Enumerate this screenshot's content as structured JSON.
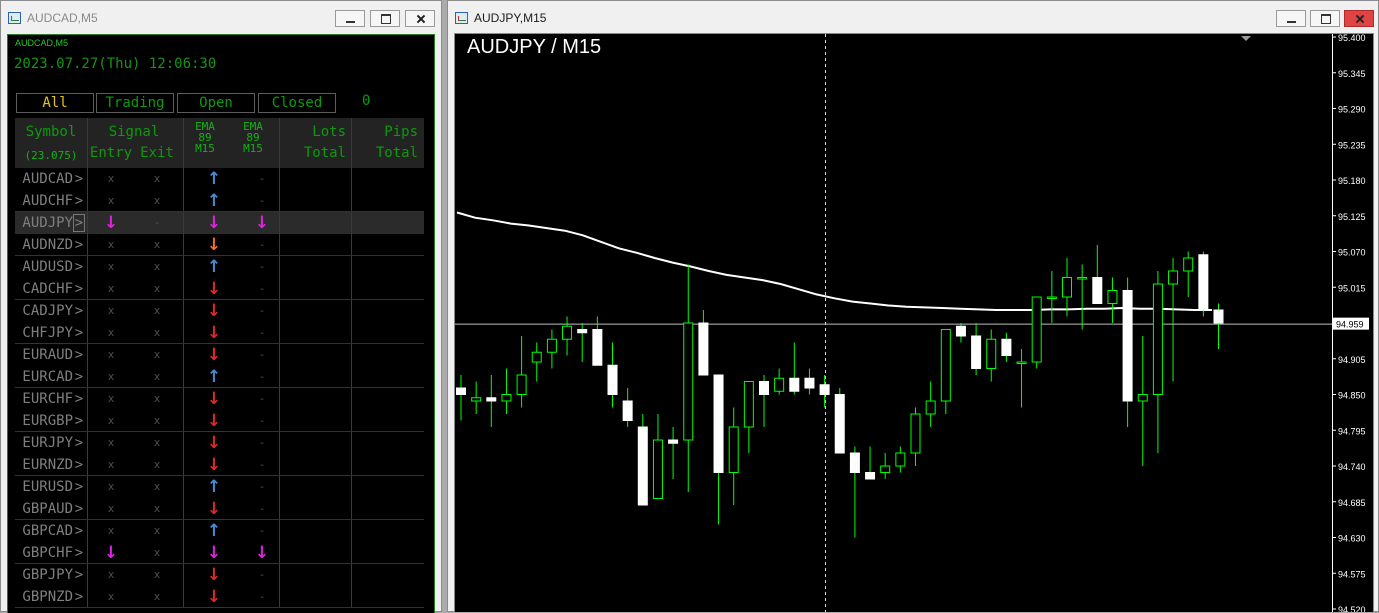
{
  "left_window": {
    "title": "AUDCAD,M5",
    "buttons": {
      "minimize": "minimize",
      "maximize": "maximize",
      "close": "close"
    }
  },
  "right_window": {
    "title": "AUDJPY,M15",
    "buttons": {
      "minimize": "minimize",
      "maximize": "maximize",
      "close": "close"
    }
  },
  "dashboard": {
    "symbol": "AUDCAD,M5",
    "datetime": "2023.07.27(Thu) 12:06:30",
    "filters": [
      "All",
      "Trading",
      "Open",
      "Closed"
    ],
    "active_filter": "All",
    "count": "0",
    "headers": {
      "symbol": "Symbol",
      "symbol_sub": "(23.075)",
      "signal": "Signal",
      "entry": "Entry",
      "exit": "Exit",
      "ema1": "EMA 89 M15",
      "ema2": "EMA 89 M15",
      "lots": "Lots",
      "lots_sub": "Total",
      "pips": "Pips",
      "pips_sub": "Total"
    },
    "rows": [
      {
        "symbol": "AUDCAD",
        "chev": ">",
        "entry": "x",
        "exit": "x",
        "ema1": "↑",
        "ema1_color": "#4a8ad4",
        "ema2": "-",
        "selected": false
      },
      {
        "symbol": "AUDCHF",
        "chev": ">",
        "entry": "x",
        "exit": "x",
        "ema1": "↑",
        "ema1_color": "#4a8ad4",
        "ema2": "-",
        "selected": false
      },
      {
        "symbol": "AUDJPY",
        "chev": ">",
        "entry": "↓",
        "entry_color": "#e020e0",
        "exit": "-",
        "ema1": "↓",
        "ema1_color": "#e020e0",
        "ema2": "↓",
        "ema2_color": "#e020e0",
        "selected": true
      },
      {
        "symbol": "AUDNZD",
        "chev": ">",
        "entry": "x",
        "exit": "x",
        "ema1": "↓",
        "ema1_color": "#f07020",
        "ema2": "-",
        "selected": false
      },
      {
        "symbol": "AUDUSD",
        "chev": ">",
        "entry": "x",
        "exit": "x",
        "ema1": "↑",
        "ema1_color": "#4a8ad4",
        "ema2": "-",
        "selected": false
      },
      {
        "symbol": "CADCHF",
        "chev": ">",
        "entry": "x",
        "exit": "x",
        "ema1": "↓",
        "ema1_color": "#e02828",
        "ema2": "-",
        "selected": false
      },
      {
        "symbol": "CADJPY",
        "chev": ">",
        "entry": "x",
        "exit": "x",
        "ema1": "↓",
        "ema1_color": "#e02828",
        "ema2": "-",
        "selected": false
      },
      {
        "symbol": "CHFJPY",
        "chev": ">",
        "entry": "x",
        "exit": "x",
        "ema1": "↓",
        "ema1_color": "#e02828",
        "ema2": "-",
        "selected": false
      },
      {
        "symbol": "EURAUD",
        "chev": ">",
        "entry": "x",
        "exit": "x",
        "ema1": "↓",
        "ema1_color": "#e02828",
        "ema2": "-",
        "selected": false
      },
      {
        "symbol": "EURCAD",
        "chev": ">",
        "entry": "x",
        "exit": "x",
        "ema1": "↑",
        "ema1_color": "#4a8ad4",
        "ema2": "-",
        "selected": false
      },
      {
        "symbol": "EURCHF",
        "chev": ">",
        "entry": "x",
        "exit": "x",
        "ema1": "↓",
        "ema1_color": "#e02828",
        "ema2": "-",
        "selected": false
      },
      {
        "symbol": "EURGBP",
        "chev": ">",
        "entry": "x",
        "exit": "x",
        "ema1": "↓",
        "ema1_color": "#e02828",
        "ema2": "-",
        "selected": false
      },
      {
        "symbol": "EURJPY",
        "chev": ">",
        "entry": "x",
        "exit": "x",
        "ema1": "↓",
        "ema1_color": "#e02828",
        "ema2": "-",
        "selected": false
      },
      {
        "symbol": "EURNZD",
        "chev": ">",
        "entry": "x",
        "exit": "x",
        "ema1": "↓",
        "ema1_color": "#e02828",
        "ema2": "-",
        "selected": false
      },
      {
        "symbol": "EURUSD",
        "chev": ">",
        "entry": "x",
        "exit": "x",
        "ema1": "↑",
        "ema1_color": "#4a8ad4",
        "ema2": "-",
        "selected": false
      },
      {
        "symbol": "GBPAUD",
        "chev": ">",
        "entry": "x",
        "exit": "x",
        "ema1": "↓",
        "ema1_color": "#e02828",
        "ema2": "-",
        "selected": false
      },
      {
        "symbol": "GBPCAD",
        "chev": ">",
        "entry": "x",
        "exit": "x",
        "ema1": "↑",
        "ema1_color": "#4a8ad4",
        "ema2": "-",
        "selected": false
      },
      {
        "symbol": "GBPCHF",
        "chev": ">",
        "entry": "↓",
        "entry_color": "#e020e0",
        "exit": "x",
        "ema1": "↓",
        "ema1_color": "#e020e0",
        "ema2": "↓",
        "ema2_color": "#e020e0",
        "selected": false
      },
      {
        "symbol": "GBPJPY",
        "chev": ">",
        "entry": "x",
        "exit": "x",
        "ema1": "↓",
        "ema1_color": "#e02828",
        "ema2": "-",
        "selected": false
      },
      {
        "symbol": "GBPNZD",
        "chev": ">",
        "entry": "x",
        "exit": "x",
        "ema1": "↓",
        "ema1_color": "#e02828",
        "ema2": "-",
        "selected": false
      }
    ]
  },
  "chart_data": {
    "type": "candlestick",
    "title": "AUDJPY / M15",
    "ylim": [
      94.5,
      95.4
    ],
    "y_ticks": [
      "95.400",
      "95.345",
      "95.290",
      "95.235",
      "95.180",
      "95.125",
      "95.070",
      "95.015",
      "94.960",
      "94.905",
      "94.850",
      "94.795",
      "94.740",
      "94.685",
      "94.630",
      "94.575",
      "94.520"
    ],
    "current_price": "94.959",
    "colors": {
      "bull_body": "#000000",
      "bear_body": "#ffffff",
      "wick": "#00ff00",
      "ma_line": "#ffffff",
      "price_line": "#c0c0c0"
    },
    "candles": [
      {
        "o": 94.86,
        "h": 94.88,
        "l": 94.81,
        "c": 94.85
      },
      {
        "o": 94.84,
        "h": 94.87,
        "l": 94.82,
        "c": 94.845
      },
      {
        "o": 94.845,
        "h": 94.88,
        "l": 94.8,
        "c": 94.84
      },
      {
        "o": 94.84,
        "h": 94.89,
        "l": 94.82,
        "c": 94.85
      },
      {
        "o": 94.85,
        "h": 94.94,
        "l": 94.83,
        "c": 94.88
      },
      {
        "o": 94.9,
        "h": 94.93,
        "l": 94.87,
        "c": 94.915
      },
      {
        "o": 94.915,
        "h": 94.95,
        "l": 94.89,
        "c": 94.935
      },
      {
        "o": 94.935,
        "h": 94.97,
        "l": 94.91,
        "c": 94.955
      },
      {
        "o": 94.95,
        "h": 94.96,
        "l": 94.9,
        "c": 94.945
      },
      {
        "o": 94.95,
        "h": 94.97,
        "l": 94.9,
        "c": 94.895
      },
      {
        "o": 94.895,
        "h": 94.93,
        "l": 94.83,
        "c": 94.85
      },
      {
        "o": 94.84,
        "h": 94.86,
        "l": 94.8,
        "c": 94.81
      },
      {
        "o": 94.8,
        "h": 94.82,
        "l": 94.68,
        "c": 94.68
      },
      {
        "o": 94.69,
        "h": 94.82,
        "l": 94.69,
        "c": 94.78
      },
      {
        "o": 94.78,
        "h": 94.8,
        "l": 94.72,
        "c": 94.775
      },
      {
        "o": 94.78,
        "h": 95.05,
        "l": 94.7,
        "c": 94.96
      },
      {
        "o": 94.96,
        "h": 94.98,
        "l": 94.88,
        "c": 94.88
      },
      {
        "o": 94.88,
        "h": 94.88,
        "l": 94.65,
        "c": 94.73
      },
      {
        "o": 94.73,
        "h": 94.83,
        "l": 94.68,
        "c": 94.8
      },
      {
        "o": 94.8,
        "h": 94.87,
        "l": 94.76,
        "c": 94.87
      },
      {
        "o": 94.87,
        "h": 94.88,
        "l": 94.8,
        "c": 94.85
      },
      {
        "o": 94.855,
        "h": 94.89,
        "l": 94.85,
        "c": 94.875
      },
      {
        "o": 94.875,
        "h": 94.93,
        "l": 94.85,
        "c": 94.855
      },
      {
        "o": 94.875,
        "h": 94.89,
        "l": 94.85,
        "c": 94.86
      },
      {
        "o": 94.865,
        "h": 94.88,
        "l": 94.83,
        "c": 94.85
      },
      {
        "o": 94.85,
        "h": 94.86,
        "l": 94.76,
        "c": 94.76
      },
      {
        "o": 94.76,
        "h": 94.77,
        "l": 94.63,
        "c": 94.73
      },
      {
        "o": 94.73,
        "h": 94.77,
        "l": 94.72,
        "c": 94.72
      },
      {
        "o": 94.73,
        "h": 94.76,
        "l": 94.72,
        "c": 94.74
      },
      {
        "o": 94.74,
        "h": 94.77,
        "l": 94.73,
        "c": 94.76
      },
      {
        "o": 94.76,
        "h": 94.83,
        "l": 94.74,
        "c": 94.82
      },
      {
        "o": 94.82,
        "h": 94.87,
        "l": 94.8,
        "c": 94.84
      },
      {
        "o": 94.84,
        "h": 94.95,
        "l": 94.82,
        "c": 94.95
      },
      {
        "o": 94.955,
        "h": 94.96,
        "l": 94.93,
        "c": 94.94
      },
      {
        "o": 94.94,
        "h": 94.96,
        "l": 94.88,
        "c": 94.89
      },
      {
        "o": 94.89,
        "h": 94.95,
        "l": 94.87,
        "c": 94.935
      },
      {
        "o": 94.935,
        "h": 94.945,
        "l": 94.9,
        "c": 94.91
      },
      {
        "o": 94.9,
        "h": 94.92,
        "l": 94.83,
        "c": 94.9
      },
      {
        "o": 94.9,
        "h": 95.0,
        "l": 94.89,
        "c": 95.0
      },
      {
        "o": 95.0,
        "h": 95.04,
        "l": 94.96,
        "c": 95.0
      },
      {
        "o": 95.0,
        "h": 95.06,
        "l": 94.97,
        "c": 95.03
      },
      {
        "o": 95.03,
        "h": 95.05,
        "l": 94.95,
        "c": 95.03
      },
      {
        "o": 95.03,
        "h": 95.08,
        "l": 94.99,
        "c": 94.99
      },
      {
        "o": 94.99,
        "h": 95.03,
        "l": 94.96,
        "c": 95.01
      },
      {
        "o": 95.01,
        "h": 95.03,
        "l": 94.8,
        "c": 94.84
      },
      {
        "o": 94.84,
        "h": 94.94,
        "l": 94.74,
        "c": 94.85
      },
      {
        "o": 94.85,
        "h": 95.04,
        "l": 94.76,
        "c": 95.02
      },
      {
        "o": 95.02,
        "h": 95.06,
        "l": 94.87,
        "c": 95.04
      },
      {
        "o": 95.04,
        "h": 95.07,
        "l": 95.0,
        "c": 95.06
      },
      {
        "o": 95.065,
        "h": 95.07,
        "l": 94.97,
        "c": 94.98
      },
      {
        "o": 94.98,
        "h": 94.99,
        "l": 94.92,
        "c": 94.96
      }
    ],
    "ma_points": [
      95.13,
      95.122,
      95.118,
      95.113,
      95.11,
      95.106,
      95.102,
      95.095,
      95.085,
      95.075,
      95.068,
      95.06,
      95.053,
      95.047,
      95.04,
      95.034,
      95.03,
      95.026,
      95.02,
      95.012,
      95.004,
      94.998,
      94.993,
      94.99,
      94.987,
      94.985,
      94.984,
      94.983,
      94.982,
      94.981,
      94.98,
      94.98,
      94.98,
      94.981,
      94.981,
      94.982,
      94.982,
      94.983,
      94.982,
      94.982,
      94.981,
      94.98,
      94.98
    ]
  }
}
